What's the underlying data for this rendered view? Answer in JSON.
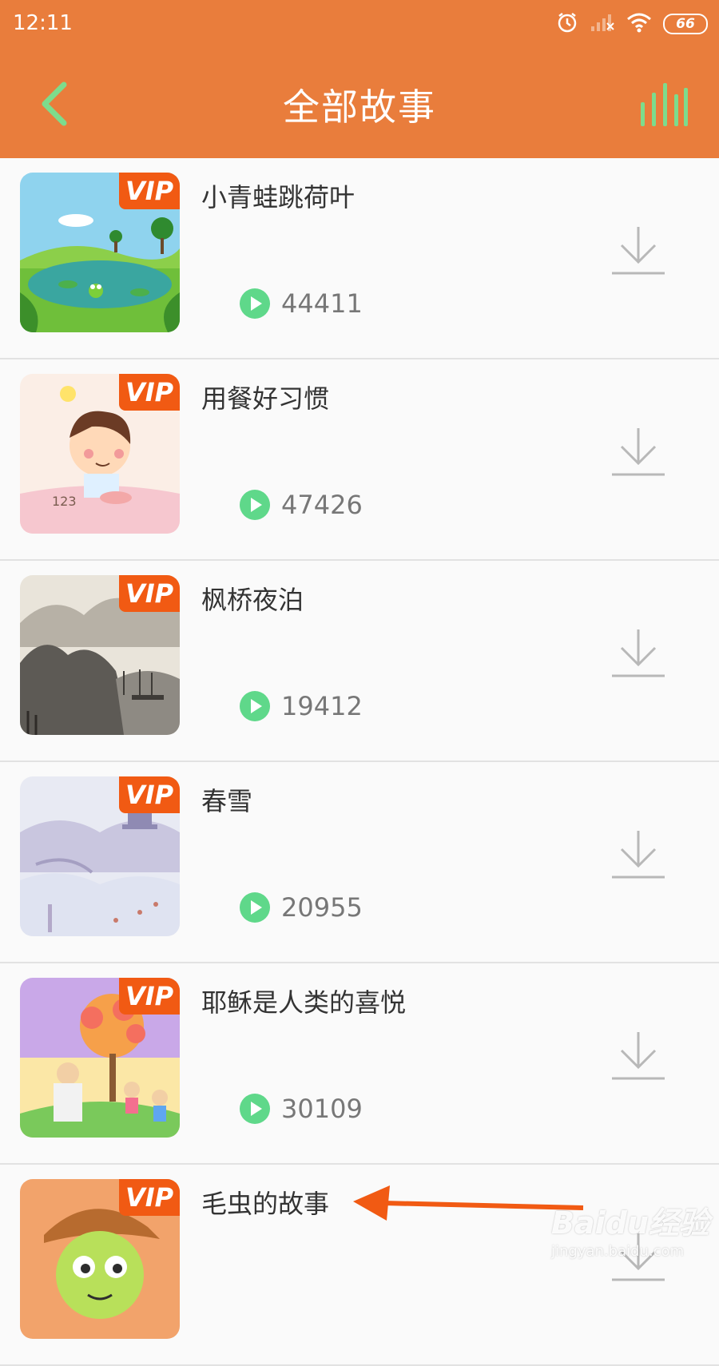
{
  "status_bar": {
    "time": "12:11",
    "battery": "66",
    "icons": [
      "alarm-icon",
      "signal-icon",
      "wifi-icon",
      "battery-icon"
    ]
  },
  "header": {
    "title": "全部故事",
    "back_icon": "chevron-left-icon",
    "right_icon": "equalizer-icon"
  },
  "colors": {
    "header_bg": "#e97d3c",
    "vip_badge": "#f15a13",
    "play_icon": "#5fd88a",
    "header_icon": "#7ddc8c",
    "annotation_arrow": "#f15a13"
  },
  "stories": [
    {
      "title": "小青蛙跳荷叶",
      "plays": "44411",
      "badge": "VIP"
    },
    {
      "title": "用餐好习惯",
      "plays": "47426",
      "badge": "VIP"
    },
    {
      "title": "枫桥夜泊",
      "plays": "19412",
      "badge": "VIP"
    },
    {
      "title": "春雪",
      "plays": "20955",
      "badge": "VIP"
    },
    {
      "title": "耶稣是人类的喜悦",
      "plays": "30109",
      "badge": "VIP"
    },
    {
      "title": "毛虫的故事",
      "plays": "",
      "badge": "VIP"
    }
  ],
  "watermark": {
    "brand": "Baidu经验",
    "url": "jingyan.baidu.com"
  }
}
